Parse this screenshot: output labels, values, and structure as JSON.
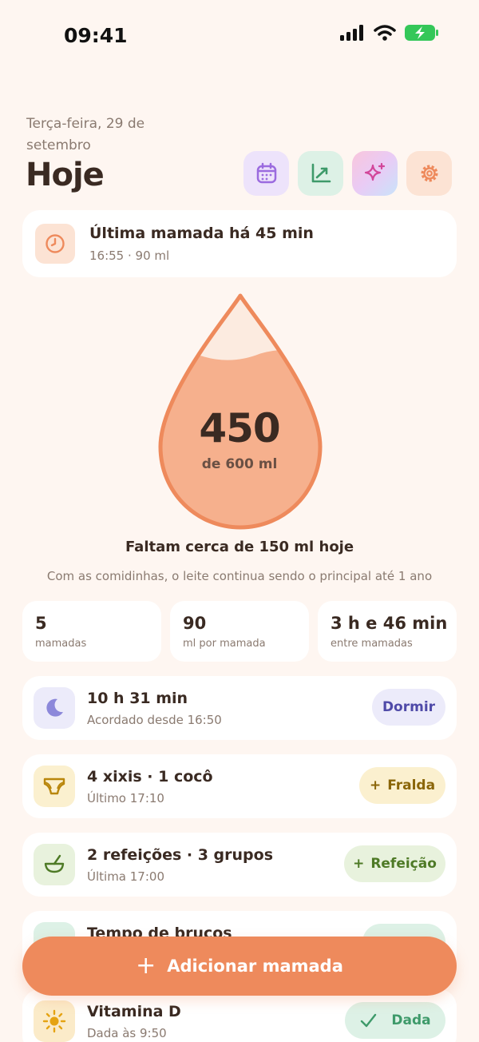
{
  "status_bar": {
    "time": "09:41"
  },
  "header": {
    "date": "Terça-feira, 29 de setembro",
    "title": "Hoje",
    "actions": [
      {
        "icon": "calendar-icon",
        "color": "#EDE3FB"
      },
      {
        "icon": "chart-icon",
        "color": "#DDF1E6"
      },
      {
        "icon": "sparkles-icon",
        "color": "gradient"
      },
      {
        "icon": "gear-icon",
        "color": "#FCE3D4"
      }
    ]
  },
  "last_feeding": {
    "icon": "clock-icon",
    "title": "Última mamada há 45 min",
    "subtitle": "16:55 · 90 ml"
  },
  "daily_goal": {
    "consumed_ml": 450,
    "target_ml": 600,
    "value": "450",
    "label": "de 600 ml",
    "fill_fraction": 0.75,
    "remaining_text": "Faltam cerca de 150 ml hoje",
    "note": "Com as comidinhas, o leite continua sendo o principal até 1 ano"
  },
  "stats": [
    {
      "value": "5",
      "label": "mamadas"
    },
    {
      "value": "90",
      "label": "ml por mamada"
    },
    {
      "value": "3 h e 46 min",
      "label": "entre mamadas"
    }
  ],
  "sleep": {
    "icon": "moon-icon",
    "title": "10 h 31 min",
    "subtitle": "Acordado desde 16:50",
    "button": "Dormir",
    "color": "#ECEBFA"
  },
  "diaper": {
    "icon": "diaper-icon",
    "title": "4 xixis · 1 cocô",
    "subtitle": "Último 17:10",
    "button_plus": "+",
    "button": "Fralda",
    "color": "#FBF0CF"
  },
  "meals": {
    "icon": "bowl-icon",
    "title": "2 refeições · 3 grupos",
    "subtitle": "Última 17:00",
    "button_plus": "+",
    "button": "Refeição",
    "color": "#E8F2DD"
  },
  "tummy": {
    "title": "Tempo de bruços"
  },
  "vitamin": {
    "icon": "sun-icon",
    "title": "Vitamina D",
    "subtitle": "Dada às 9:50",
    "button": "Dada",
    "color": "#FBEBC9"
  },
  "cta": {
    "plus": "+",
    "label": "Adicionar mamada"
  }
}
